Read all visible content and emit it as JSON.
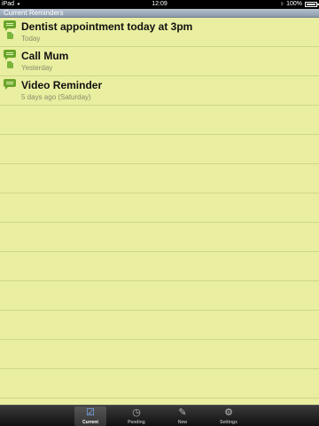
{
  "status_bar": {
    "carrier": "iPad",
    "time": "12:09",
    "battery_percent": "100%",
    "battery_level": 1.0
  },
  "header": {
    "title": "Current Reminders"
  },
  "reminders": [
    {
      "title": "Dentist appointment today at 3pm",
      "subtitle": "Today",
      "icon": "message-bubble-icon",
      "has_pin": true
    },
    {
      "title": "Call Mum",
      "subtitle": "Yesterday",
      "icon": "message-bubble-icon",
      "has_pin": true
    },
    {
      "title": "Video Reminder",
      "subtitle": "5 days ago  (Saturday)",
      "icon": "message-bubble-icon",
      "has_pin": false
    }
  ],
  "tabs": [
    {
      "label": "Current",
      "icon": "checkbox-icon",
      "active": true
    },
    {
      "label": "Pending",
      "icon": "clock-icon",
      "active": false
    },
    {
      "label": "New",
      "icon": "add-reminder-icon",
      "active": false
    },
    {
      "label": "Settings",
      "icon": "gears-icon",
      "active": false
    }
  ],
  "colors": {
    "paper": "#eaeea0",
    "rule": "#cfd68a",
    "icon_green": "#6aa52a",
    "subtitle": "#8a8c6b"
  }
}
